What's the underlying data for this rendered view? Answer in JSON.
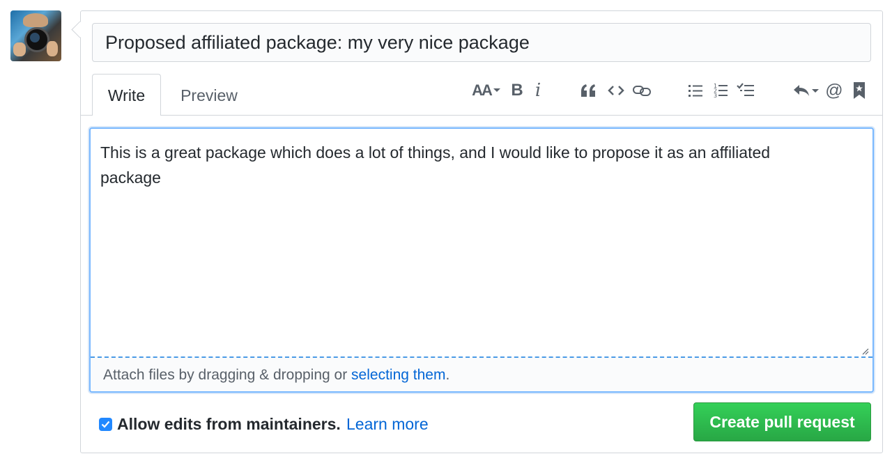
{
  "avatar": {
    "alt": "user avatar"
  },
  "title_input": {
    "value": "Proposed affiliated package: my very nice package"
  },
  "tabs": [
    {
      "label": "Write",
      "active": true
    },
    {
      "label": "Preview",
      "active": false
    }
  ],
  "toolbar": {
    "icons": [
      "text-size-icon",
      "bold-icon",
      "italic-icon",
      "quote-icon",
      "code-icon",
      "link-icon",
      "unordered-list-icon",
      "ordered-list-icon",
      "task-list-icon",
      "reply-icon",
      "mention-icon",
      "bookmark-icon"
    ],
    "heading_glyph": "AA",
    "bold_glyph": "B",
    "italic_glyph": "i",
    "mention_glyph": "@"
  },
  "editor": {
    "body": "This is a great package which does a lot of things, and I would like to propose it as an affiliated package"
  },
  "attach": {
    "prefix": "Attach files by dragging & dropping or ",
    "link": "selecting them",
    "suffix": "."
  },
  "footer": {
    "allow_edits_label": "Allow edits from maintainers.",
    "allow_edits_checked": true,
    "learn_more": "Learn more",
    "submit_label": "Create pull request"
  },
  "colors": {
    "accent": "#0366d6",
    "submit_green": "#28a745",
    "focus_border": "#79b8ff"
  }
}
